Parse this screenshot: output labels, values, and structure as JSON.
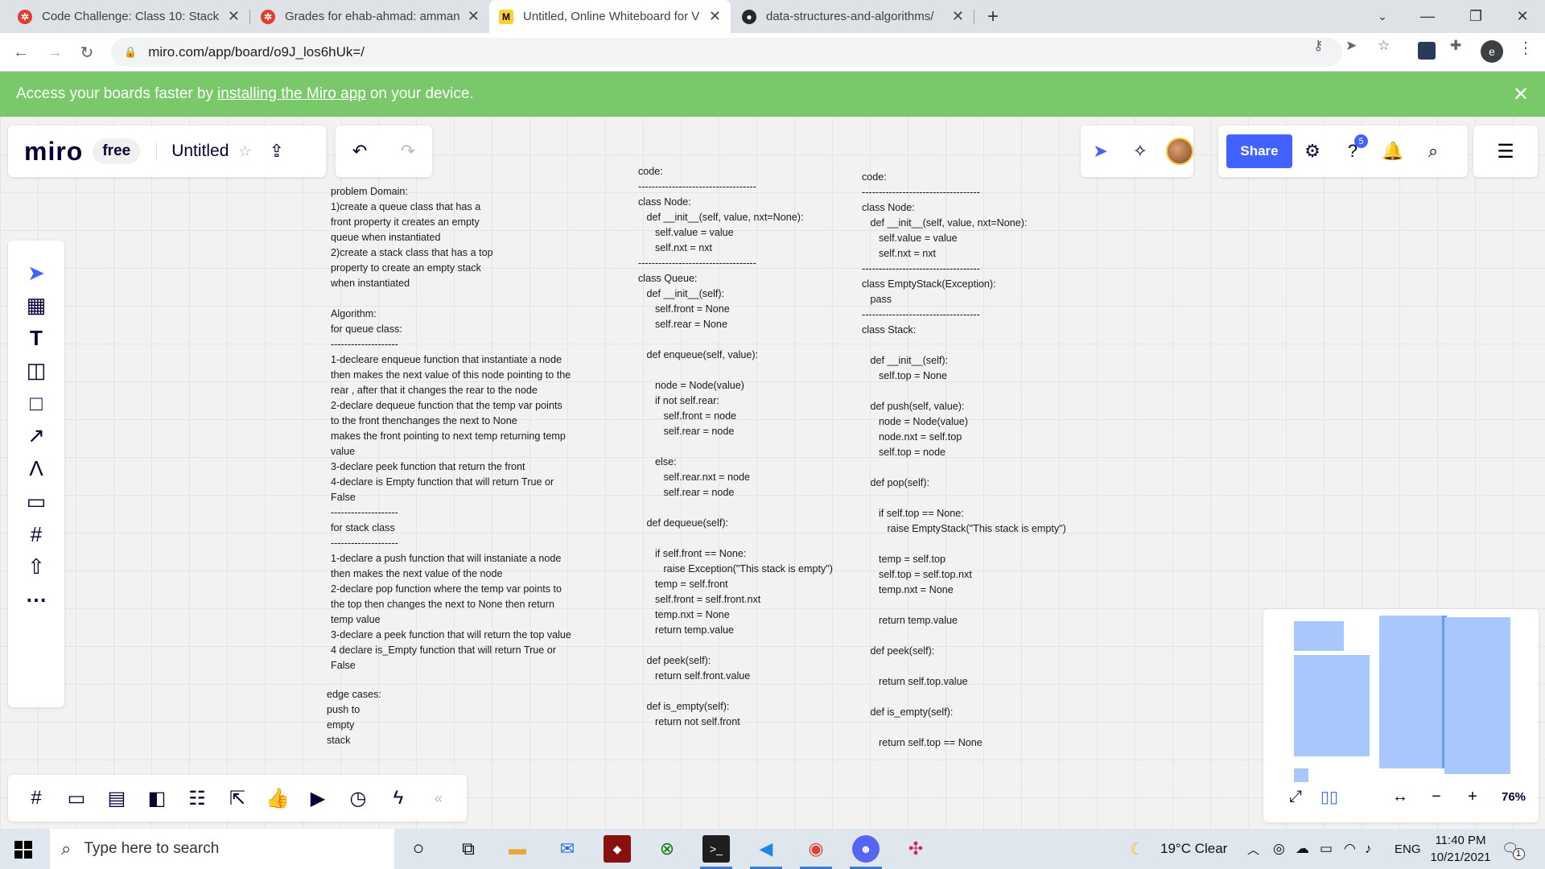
{
  "browser": {
    "tabs": [
      {
        "title": "Code Challenge: Class 10: Stack a",
        "icon": "canvas-icon",
        "color": "#e03c31"
      },
      {
        "title": "Grades for ehab-ahmad: amman",
        "icon": "canvas-icon",
        "color": "#e03c31"
      },
      {
        "title": "Untitled, Online Whiteboard for V",
        "icon": "miro-icon",
        "color": "#ffd02f"
      },
      {
        "title": "data-structures-and-algorithms/",
        "icon": "github-icon",
        "color": "#24292f"
      }
    ],
    "url": "miro.com/app/board/o9J_los6hUk=/",
    "profile_initial": "e"
  },
  "banner": {
    "prefix": "Access your boards faster by",
    "link": "installing the Miro app",
    "suffix": "on your device."
  },
  "miro": {
    "logo": "miro",
    "plan": "free",
    "board_title": "Untitled",
    "share": "Share",
    "help_badge": "5",
    "zoom": "76%"
  },
  "board": {
    "problem_text": "problem Domain:\n1)create a queue class that has a\nfront property it creates an empty\nqueue when instantiated\n2)create a stack class that has a top\nproperty to create an empty stack\nwhen instantiated\n\nAlgorithm:\nfor queue class:\n--------------------\n1-decleare enqueue function that instantiate a node\nthen makes the next value of this node pointing to the\nrear , after that it changes the rear to the node\n2-declare dequeue function that the temp var points\nto the front thenchanges the next to None\nmakes the front pointing to next temp returning temp\nvalue\n3-declare peek function that return the front\n4-declare is Empty function that will return True or\nFalse\n--------------------\nfor stack class\n--------------------\n1-declare a push function that will instaniate a node\nthen makes the next value of the node\n2-declare pop function where the temp var points to\nthe top then changes the next to None then return\ntemp value\n3-declare a peek function that will return the top value\n4 declare is_Empty function that will return True or\nFalse",
    "edge_text": "edge cases:\npush to\nempty\nstack",
    "queue_code": "code:\n-----------------------------------\nclass Node:\n   def __init__(self, value, nxt=None):\n      self.value = value\n      self.nxt = nxt\n-----------------------------------\nclass Queue:\n   def __init__(self):\n      self.front = None\n      self.rear = None\n\n   def enqueue(self, value):\n\n      node = Node(value)\n      if not self.rear:\n         self.front = node\n         self.rear = node\n\n      else:\n         self.rear.nxt = node\n         self.rear = node\n\n   def dequeue(self):\n\n      if self.front == None:\n         raise Exception(\"This stack is empty\")\n      temp = self.front\n      self.front = self.front.nxt\n      temp.nxt = None\n      return temp.value\n\n   def peek(self):\n      return self.front.value\n\n   def is_empty(self):\n      return not self.front",
    "stack_code": "code:\n-----------------------------------\nclass Node:\n   def __init__(self, value, nxt=None):\n      self.value = value\n      self.nxt = nxt\n-----------------------------------\nclass EmptyStack(Exception):\n   pass\n-----------------------------------\nclass Stack:\n\n   def __init__(self):\n      self.top = None\n\n   def push(self, value):\n      node = Node(value)\n      node.nxt = self.top\n      self.top = node\n\n   def pop(self):\n\n      if self.top == None:\n         raise EmptyStack(\"This stack is empty\")\n\n      temp = self.top\n      self.top = self.top.nxt\n      temp.nxt = None\n\n      return temp.value\n\n   def peek(self):\n\n      return self.top.value\n\n   def is_empty(self):\n\n      return self.top == None"
  },
  "taskbar": {
    "search_placeholder": "Type here to search",
    "weather": "19°C  Clear",
    "lang": "ENG",
    "time": "11:40 PM",
    "date": "10/21/2021",
    "notif_count": "1"
  }
}
